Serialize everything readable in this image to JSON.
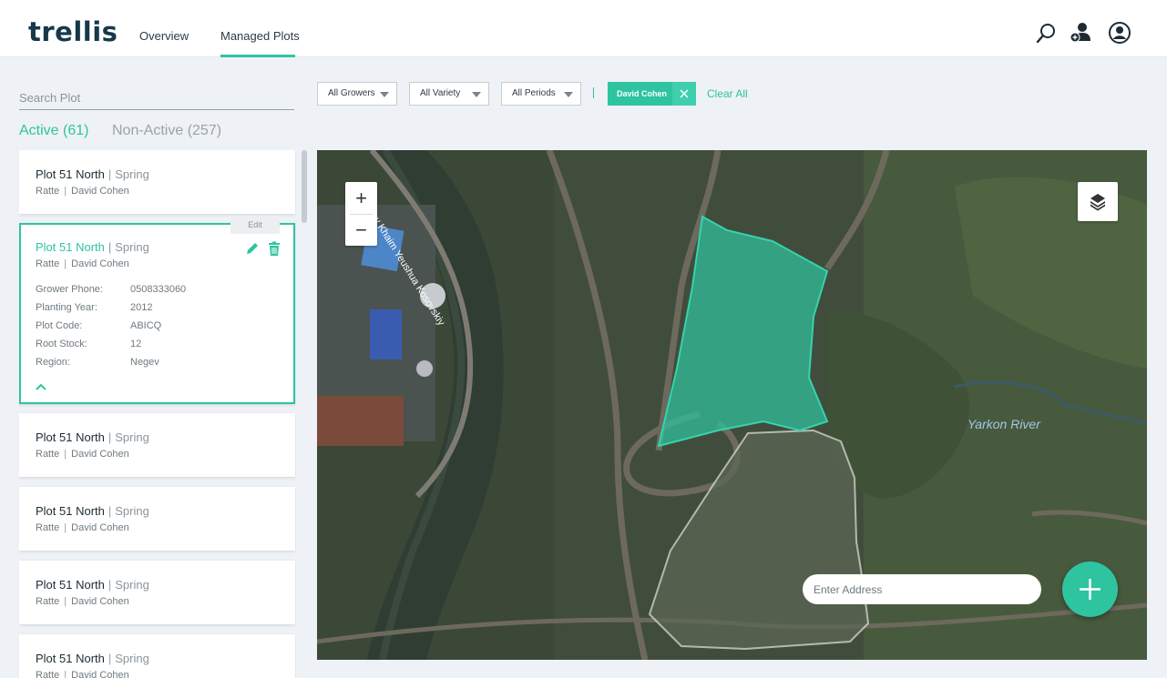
{
  "app": {
    "logo": "trellis",
    "nav": [
      {
        "label": "Overview"
      },
      {
        "label": "Managed Plots"
      }
    ],
    "icons": [
      "search-icon",
      "add-user-icon",
      "account-icon"
    ]
  },
  "sidebar": {
    "search_placeholder": "Search Plot",
    "tabs": {
      "active": "Active (61)",
      "inactive": "Non-Active (257)"
    },
    "plots": [
      {
        "name": "Plot 51 North",
        "season": "Spring",
        "variety": "Ratte",
        "grower": "David Cohen"
      },
      {
        "name": "Plot 51 North",
        "season": "Spring",
        "variety": "Ratte",
        "grower": "David Cohen",
        "edit_tooltip": "Edit",
        "details": [
          {
            "key": "Grower Phone:",
            "value": "0508333060"
          },
          {
            "key": "Planting Year:",
            "value": "2012"
          },
          {
            "key": "Plot Code:",
            "value": "ABICQ"
          },
          {
            "key": "Root Stock:",
            "value": "12"
          },
          {
            "key": "Region:",
            "value": "Negev"
          }
        ]
      },
      {
        "name": "Plot 51 North",
        "season": "Spring",
        "variety": "Ratte",
        "grower": "David Cohen"
      },
      {
        "name": "Plot 51 North",
        "season": "Spring",
        "variety": "Ratte",
        "grower": "David Cohen"
      },
      {
        "name": "Plot 51 North",
        "season": "Spring",
        "variety": "Ratte",
        "grower": "David Cohen"
      },
      {
        "name": "Plot 51 North",
        "season": "Spring",
        "variety": "Ratte",
        "grower": "David Cohen"
      }
    ],
    "separator": "|"
  },
  "filters": {
    "growers": "All Growers",
    "variety": "All Variety",
    "periods": "All Periods",
    "active_chip": "David Cohen",
    "clear_all": "Clear All"
  },
  "map": {
    "zoom_in": "+",
    "zoom_out": "−",
    "address_placeholder": "Enter Address",
    "river_label": "Yarkon River",
    "street_label": "Rav Khaim Yeushua Kosovskiy"
  },
  "colors": {
    "accent": "#2ec4a0",
    "brand": "#16384a"
  }
}
